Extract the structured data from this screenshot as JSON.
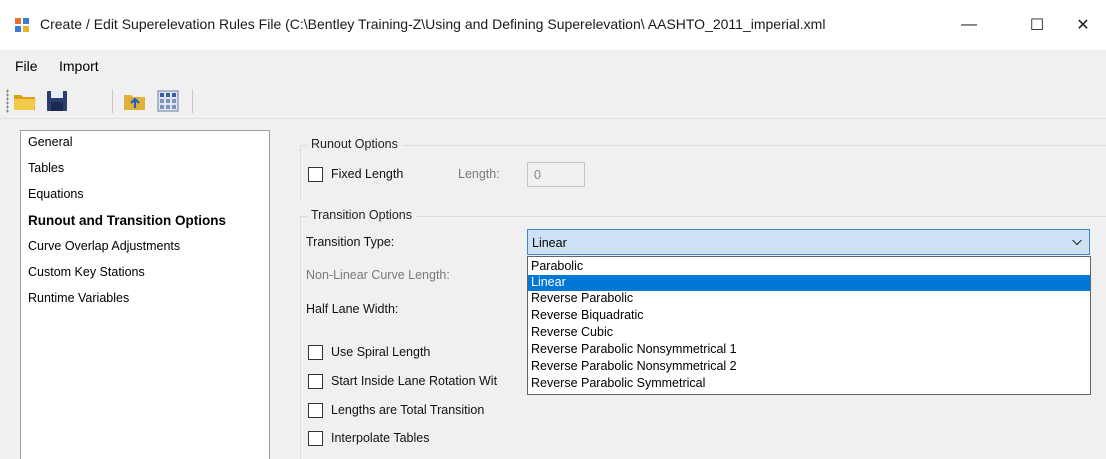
{
  "window": {
    "title": "Create / Edit Superelevation Rules File (C:\\Bentley Training-Z\\Using and Defining Superelevation\\ AASHTO_2011_imperial.xml",
    "minimize_glyph": "—",
    "maximize_glyph": "☐",
    "close_glyph": "✕"
  },
  "menu": {
    "file": "File",
    "import": "Import"
  },
  "toolbar": {
    "icons": [
      "folder-open-icon",
      "save-icon",
      "import-icon",
      "grid-icon"
    ]
  },
  "nav": {
    "items": [
      {
        "label": "General"
      },
      {
        "label": "Tables"
      },
      {
        "label": "Equations"
      },
      {
        "label": "Runout and Transition Options"
      },
      {
        "label": "Curve Overlap Adjustments"
      },
      {
        "label": "Custom Key Stations"
      },
      {
        "label": "Runtime Variables"
      }
    ],
    "selected": "Runout and Transition Options"
  },
  "runout": {
    "group_title": "Runout Options",
    "fixed_length_label": "Fixed Length",
    "fixed_length_checked": false,
    "length_label": "Length:",
    "length_value": "0"
  },
  "transition": {
    "group_title": "Transition Options",
    "type_label": "Transition Type:",
    "type_value": "Linear",
    "nonlinear_label": "Non-Linear Curve Length:",
    "half_lane_label": "Half Lane Width:",
    "use_spiral_label": "Use Spiral Length",
    "start_inside_label": "Start Inside Lane Rotation Wit",
    "lengths_total_label": "Lengths are Total Transition",
    "interpolate_label": "Interpolate Tables"
  },
  "dropdown": {
    "options": [
      "Parabolic",
      "Linear",
      "Reverse Parabolic",
      "Reverse Biquadratic",
      "Reverse Cubic",
      "Reverse Parabolic Nonsymmetrical 1",
      "Reverse Parabolic Nonsymmetrical 2",
      "Reverse Parabolic Symmetrical"
    ],
    "highlighted": "Linear"
  },
  "colors": {
    "highlight": "#0078d7",
    "combo_background": "#cde3f5",
    "combo_border": "#3b86cc"
  }
}
